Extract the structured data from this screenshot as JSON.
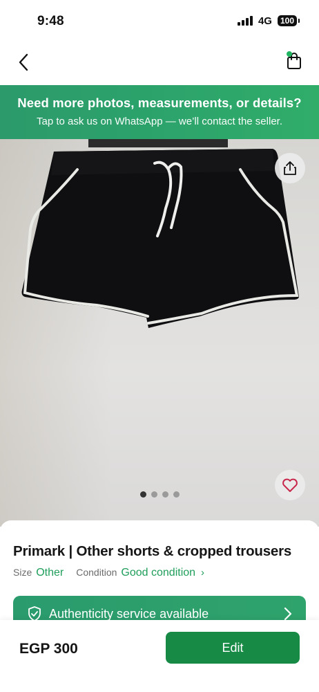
{
  "status_bar": {
    "time": "9:48",
    "network": "4G",
    "battery": "100"
  },
  "banner": {
    "title": "Need more photos, measurements, or details?",
    "subtitle": "Tap to ask us on WhatsApp — we’ll contact the seller."
  },
  "gallery": {
    "photo_count": 4,
    "active_index": 0
  },
  "product": {
    "title": "Primark | Other shorts & cropped trousers",
    "size_label": "Size",
    "size_value": "Other",
    "condition_label": "Condition",
    "condition_value": "Good condition",
    "authenticity_text": "Authenticity service available"
  },
  "bottom": {
    "price": "EGP 300",
    "edit_label": "Edit"
  },
  "colors": {
    "accent": "#1e9e5a",
    "button": "#178a45",
    "banner": "#2ca36b"
  }
}
